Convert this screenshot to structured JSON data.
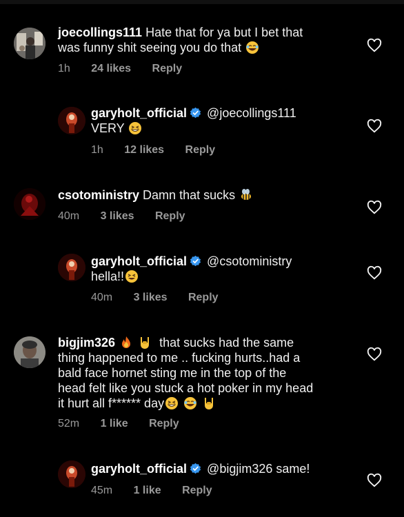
{
  "comments": [
    {
      "user": "joecollings111",
      "text_line1": "Hate that for ya but I bet that",
      "text_line2": "was funny shit seeing you do that",
      "time": "1h",
      "likes": "24 likes",
      "reply": "Reply"
    },
    {
      "user": "garyholt_official",
      "mention": "@joecollings111",
      "text": "VERY",
      "time": "1h",
      "likes": "12 likes",
      "reply": "Reply"
    },
    {
      "user": "csotoministry",
      "text": "Damn that sucks",
      "time": "40m",
      "likes": "3 likes",
      "reply": "Reply"
    },
    {
      "user": "garyholt_official",
      "mention": "@csotoministry",
      "text": "hella!!",
      "time": "40m",
      "likes": "3 likes",
      "reply": "Reply"
    },
    {
      "user": "bigjim326",
      "text_line1": "that sucks had the same",
      "text_line2": "thing happened to me .. fucking hurts..had a",
      "text_line3": "bald face hornet sting me in the top of the",
      "text_line4": "head felt like you stuck a hot poker in my head",
      "text_line5": "it hurt all f****** day",
      "time": "52m",
      "likes": "1 like",
      "reply": "Reply"
    },
    {
      "user": "garyholt_official",
      "mention": "@bigjim326",
      "text": "same!",
      "time": "45m",
      "likes": "1 like",
      "reply": "Reply"
    }
  ],
  "icons": {
    "like": "heart-outline-icon",
    "verified": "verified-badge-icon",
    "accent": "#3897f0"
  }
}
